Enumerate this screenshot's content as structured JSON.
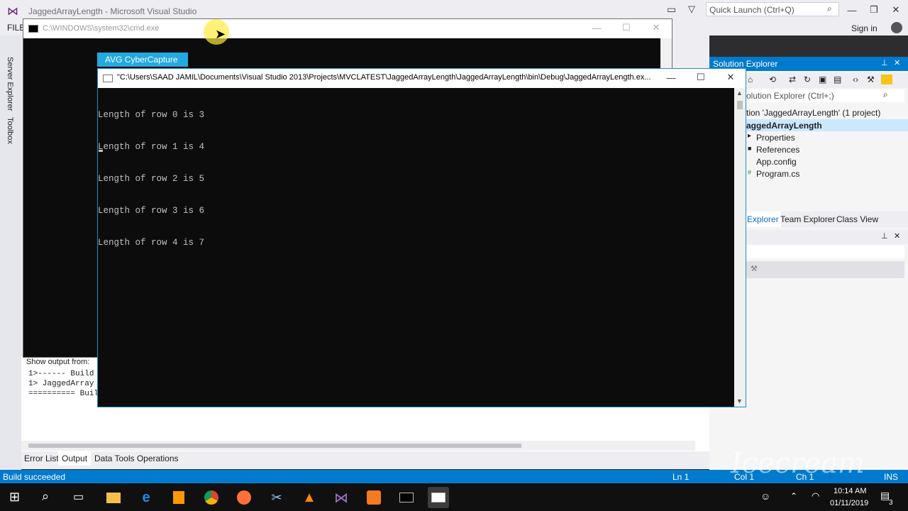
{
  "vs": {
    "title": "JaggedArrayLength - Microsoft Visual Studio",
    "menu_file": "FILE",
    "quick_launch": "Quick Launch (Ctrl+Q)",
    "sign_in": "Sign in",
    "left_tabs": [
      "Server Explorer",
      "Toolbox"
    ],
    "output": {
      "show_output_from": "Show output from:",
      "lines": [
        "1>------ Build",
        "1>  JaggedArray",
        "========== Buil"
      ]
    },
    "bottom_tabs": [
      "Error List",
      "Output",
      "Data Tools Operations"
    ],
    "status": {
      "text": "Build succeeded",
      "ln": "Ln 1",
      "col": "Col 1",
      "ch": "Ch 1",
      "ins": "INS"
    }
  },
  "solution_explorer": {
    "title": "Solution Explorer",
    "search_placeholder": "olution Explorer (Ctrl+;)",
    "solution": "tion 'JaggedArrayLength' (1 project)",
    "project": "aggedArrayLength",
    "items": [
      "Properties",
      "References",
      "App.config",
      "Program.cs"
    ],
    "tabs": [
      "Explorer",
      "Team Explorer",
      "Class View"
    ]
  },
  "cmd_window": {
    "title": "C:\\WINDOWS\\system32\\cmd.exe"
  },
  "avg": {
    "label": "AVG CyberCapture"
  },
  "console": {
    "title": "\"C:\\Users\\SAAD JAMIL\\Documents\\Visual Studio 2013\\Projects\\MVCLATEST\\JaggedArrayLength\\JaggedArrayLength\\bin\\Debug\\JaggedArrayLength.ex...",
    "lines": [
      "Length of row 0 is 3",
      "Length of row 1 is 4",
      "Length of row 2 is 5",
      "Length of row 3 is 6",
      "Length of row 4 is 7"
    ]
  },
  "taskbar": {
    "time": "10:14 AM",
    "date": "01/11/2019",
    "notification_count": "3"
  },
  "watermark": "Icecream APPS",
  "colors": {
    "vs_blue": "#007acc",
    "avg_blue": "#22a9e0",
    "console_bg": "#0c0c0c",
    "console_text": "#c0c0c0"
  }
}
